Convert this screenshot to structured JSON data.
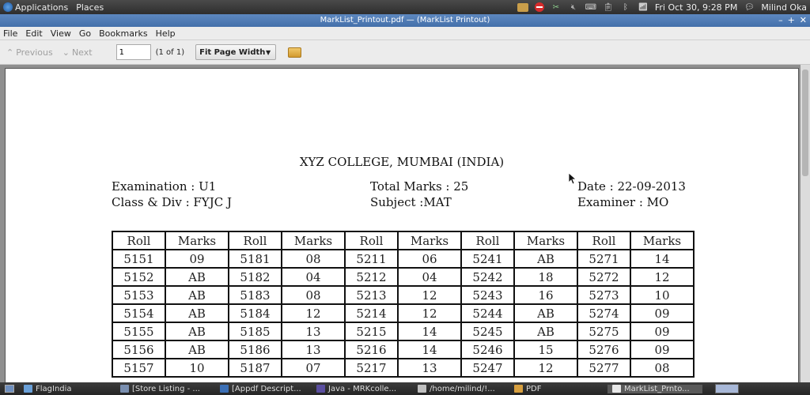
{
  "top_panel": {
    "applications": "Applications",
    "places": "Places",
    "datetime": "Fri Oct 30,  9:28 PM",
    "user": "Milind Oka"
  },
  "window": {
    "title": "MarkList_Printout.pdf — (MarkList Printout)",
    "controls": [
      "–",
      "+",
      "✕"
    ]
  },
  "menu": [
    "File",
    "Edit",
    "View",
    "Go",
    "Bookmarks",
    "Help"
  ],
  "toolbar": {
    "previous": "Previous",
    "next": "Next",
    "page_value": "1",
    "page_count": "(1 of 1)",
    "zoom": "Fit Page Width"
  },
  "document": {
    "college": "XYZ COLLEGE, MUMBAI (INDIA)",
    "examination": "Examination : U1",
    "class_div": "Class & Div : FYJC J",
    "total_marks": "Total Marks : 25",
    "subject": "Subject :MAT",
    "date": "Date : 22-09-2013",
    "examiner": "Examiner : MO",
    "table": {
      "headers": [
        "Roll",
        "Marks",
        "Roll",
        "Marks",
        "Roll",
        "Marks",
        "Roll",
        "Marks",
        "Roll",
        "Marks"
      ],
      "rows": [
        [
          "5151",
          "09",
          "5181",
          "08",
          "5211",
          "06",
          "5241",
          "AB",
          "5271",
          "14"
        ],
        [
          "5152",
          "AB",
          "5182",
          "04",
          "5212",
          "04",
          "5242",
          "18",
          "5272",
          "12"
        ],
        [
          "5153",
          "AB",
          "5183",
          "08",
          "5213",
          "12",
          "5243",
          "16",
          "5273",
          "10"
        ],
        [
          "5154",
          "AB",
          "5184",
          "12",
          "5214",
          "12",
          "5244",
          "AB",
          "5274",
          "09"
        ],
        [
          "5155",
          "AB",
          "5185",
          "13",
          "5215",
          "14",
          "5245",
          "AB",
          "5275",
          "09"
        ],
        [
          "5156",
          "AB",
          "5186",
          "13",
          "5216",
          "14",
          "5246",
          "15",
          "5276",
          "09"
        ],
        [
          "5157",
          "10",
          "5187",
          "07",
          "5217",
          "13",
          "5247",
          "12",
          "5277",
          "08"
        ]
      ]
    }
  },
  "taskbar": [
    {
      "label": "FlagIndia",
      "color": "#6aa0d8"
    },
    {
      "label": "[Store Listing - ...",
      "color": "#7a8fb0"
    },
    {
      "label": "[Appdf Descript...",
      "color": "#3b6fb5"
    },
    {
      "label": "Java - MRKcolle...",
      "color": "#5b4fa0"
    },
    {
      "label": "/home/milind/!...",
      "color": "#c0c0c0"
    },
    {
      "label": "PDF",
      "color": "#d8a040"
    },
    {
      "label": "MarkList_Prnto...",
      "color": "#e8e8e8"
    }
  ]
}
